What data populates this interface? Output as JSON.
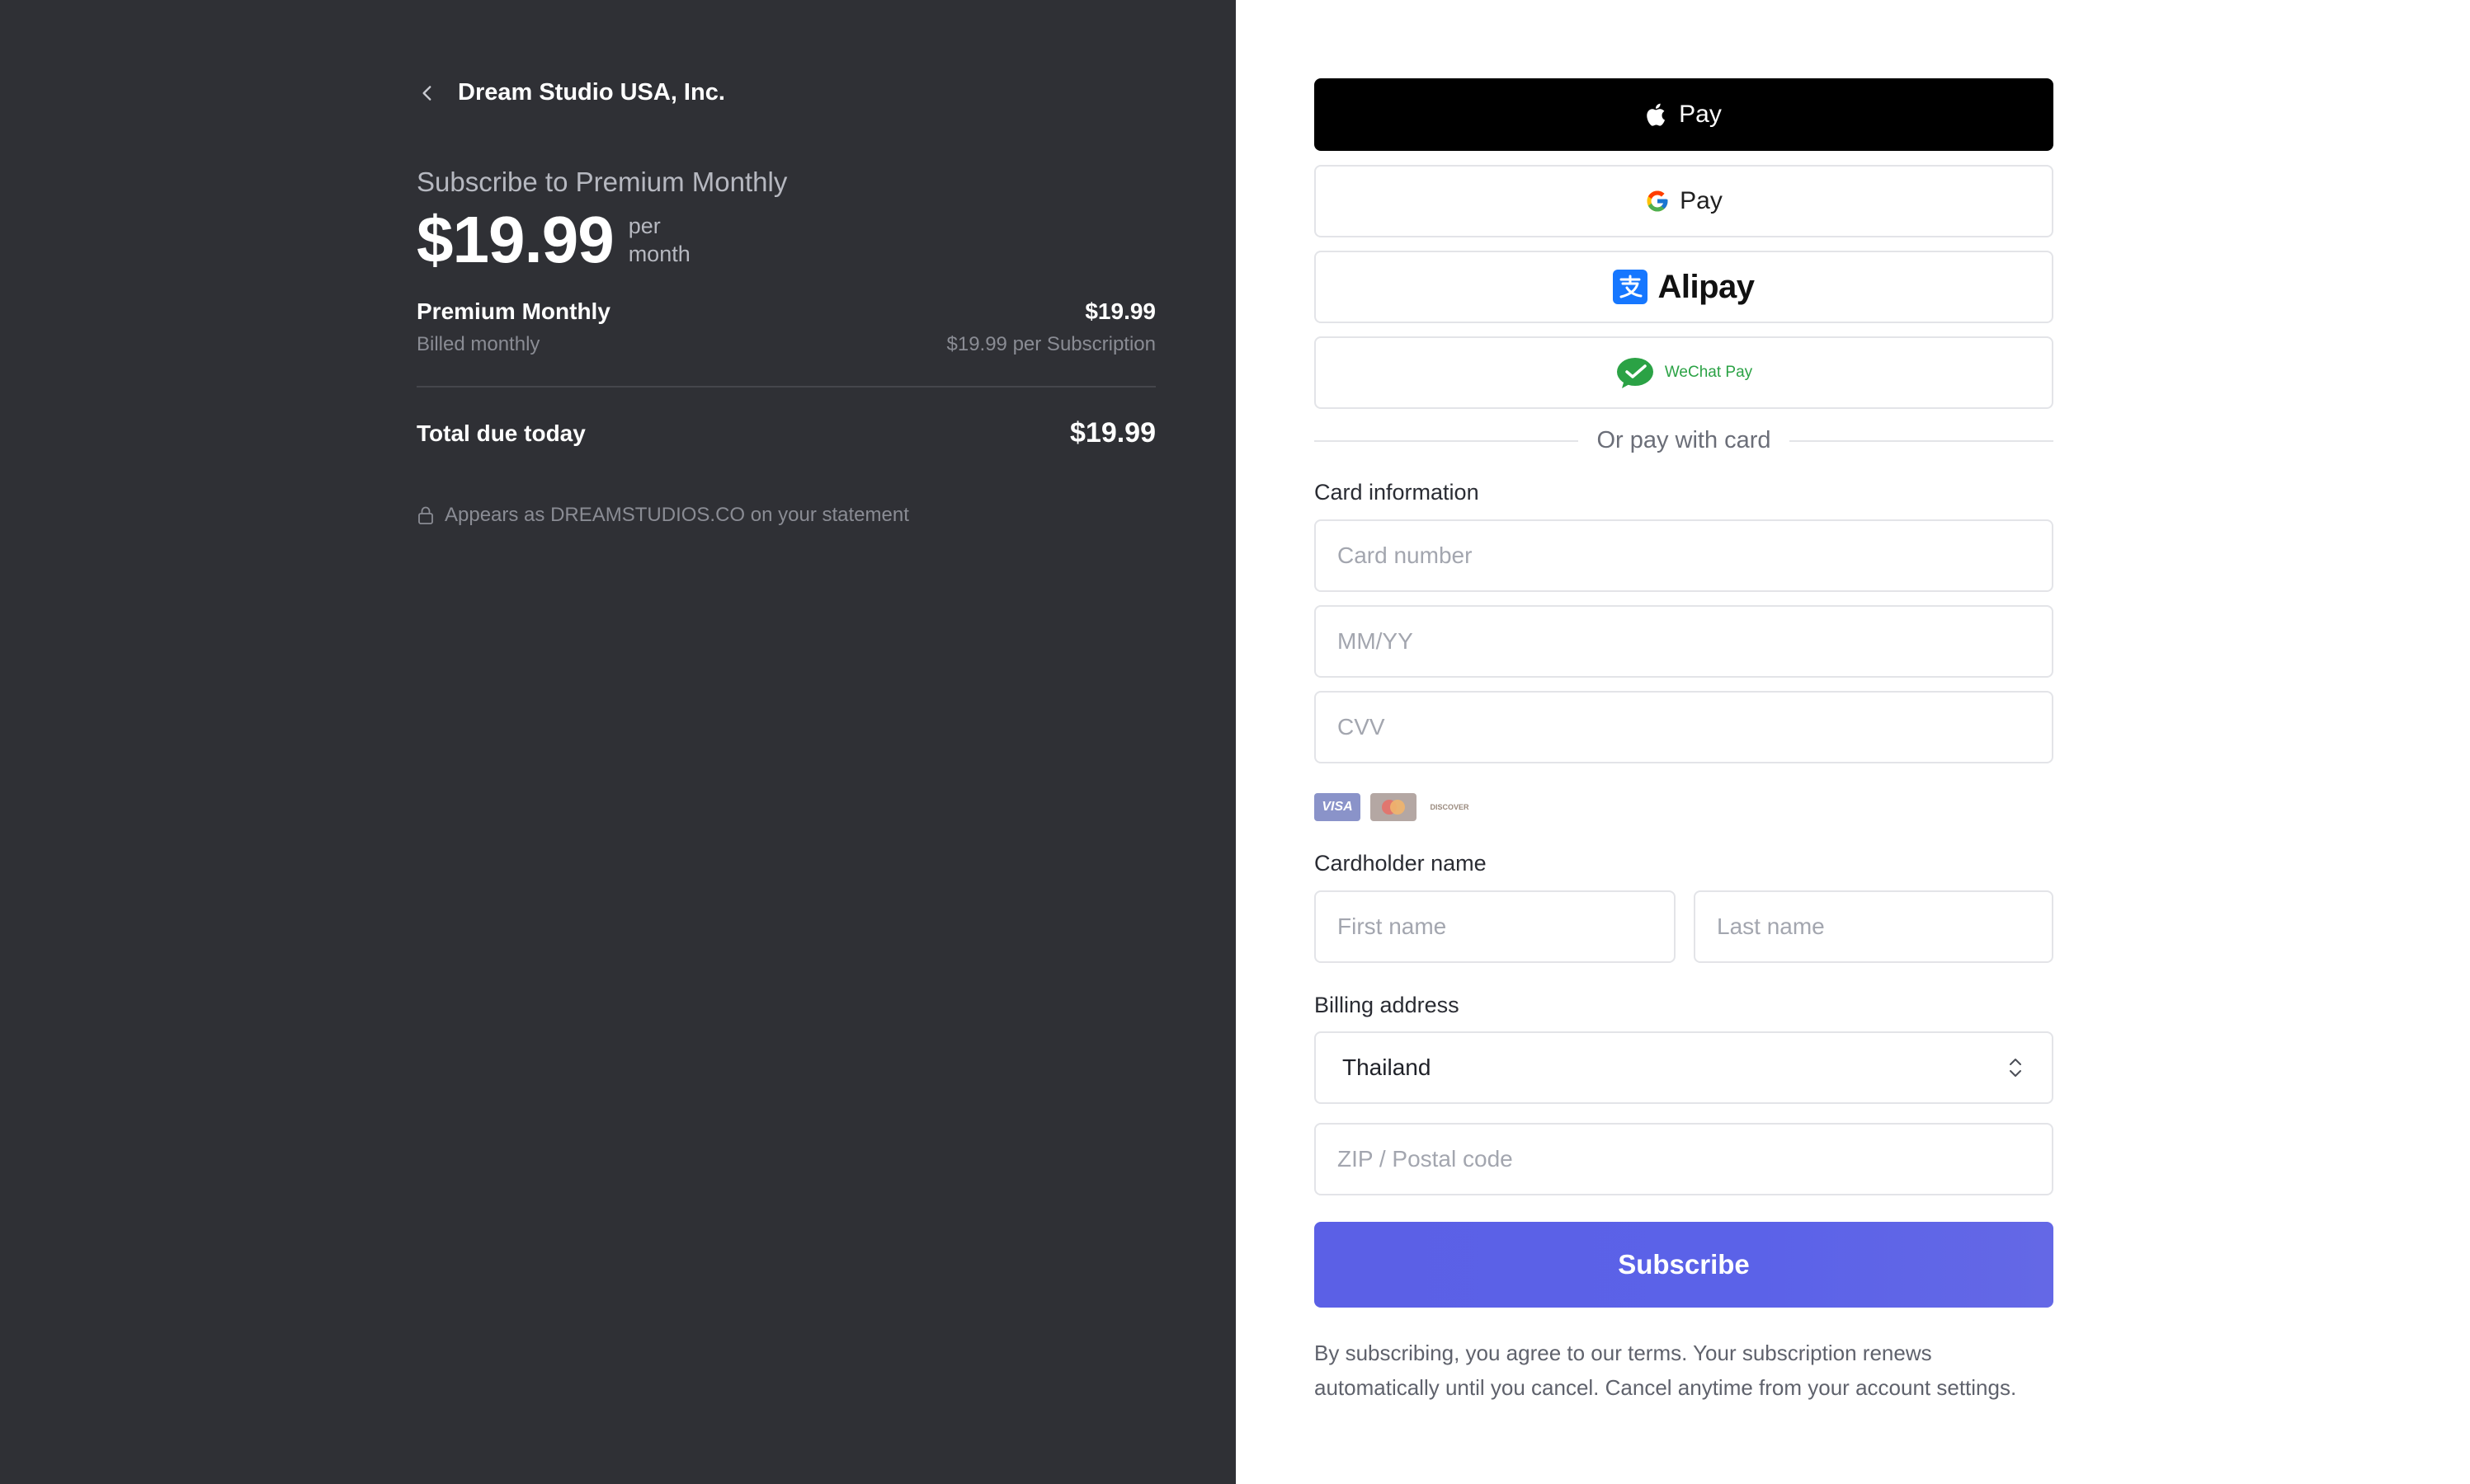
{
  "summary": {
    "merchant_name": "Dream Studio USA, Inc.",
    "subscribe_title": "Subscribe to Premium Monthly",
    "price": "$19.99",
    "per_line1": "per",
    "per_line2": "month",
    "item_name": "Premium Monthly",
    "item_price": "$19.99",
    "item_billing": "Billed monthly",
    "item_unit_price": "$19.99 per Subscription",
    "total_label": "Total due today",
    "total_price": "$19.99",
    "statement_text": "Appears as DREAMSTUDIOS.CO on your statement"
  },
  "wallets": {
    "apple_pay_label": "Pay",
    "google_pay_label": "Pay",
    "alipay_label": "Alipay",
    "wechat_label": "WeChat Pay"
  },
  "divider_text": "Or pay with card",
  "card": {
    "section_label": "Card information",
    "number_placeholder": "Card number",
    "expiry_placeholder": "MM/YY",
    "cvv_placeholder": "CVV",
    "brands": [
      "VISA",
      "Mastercard",
      "DISCOVER"
    ]
  },
  "cardholder": {
    "section_label": "Cardholder name",
    "first_placeholder": "First name",
    "last_placeholder": "Last name"
  },
  "billing": {
    "section_label": "Billing address",
    "country_value": "Thailand",
    "zip_placeholder": "ZIP / Postal code"
  },
  "subscribe_label": "Subscribe",
  "terms_text": "By subscribing, you agree to our terms. Your subscription renews automatically until you cancel. Cancel anytime from your account settings.",
  "colors": {
    "left_panel_bg": "#2f3035",
    "accent": "#5b60e6",
    "wechat_green": "#2ba245",
    "alipay_blue": "#1677ff"
  }
}
